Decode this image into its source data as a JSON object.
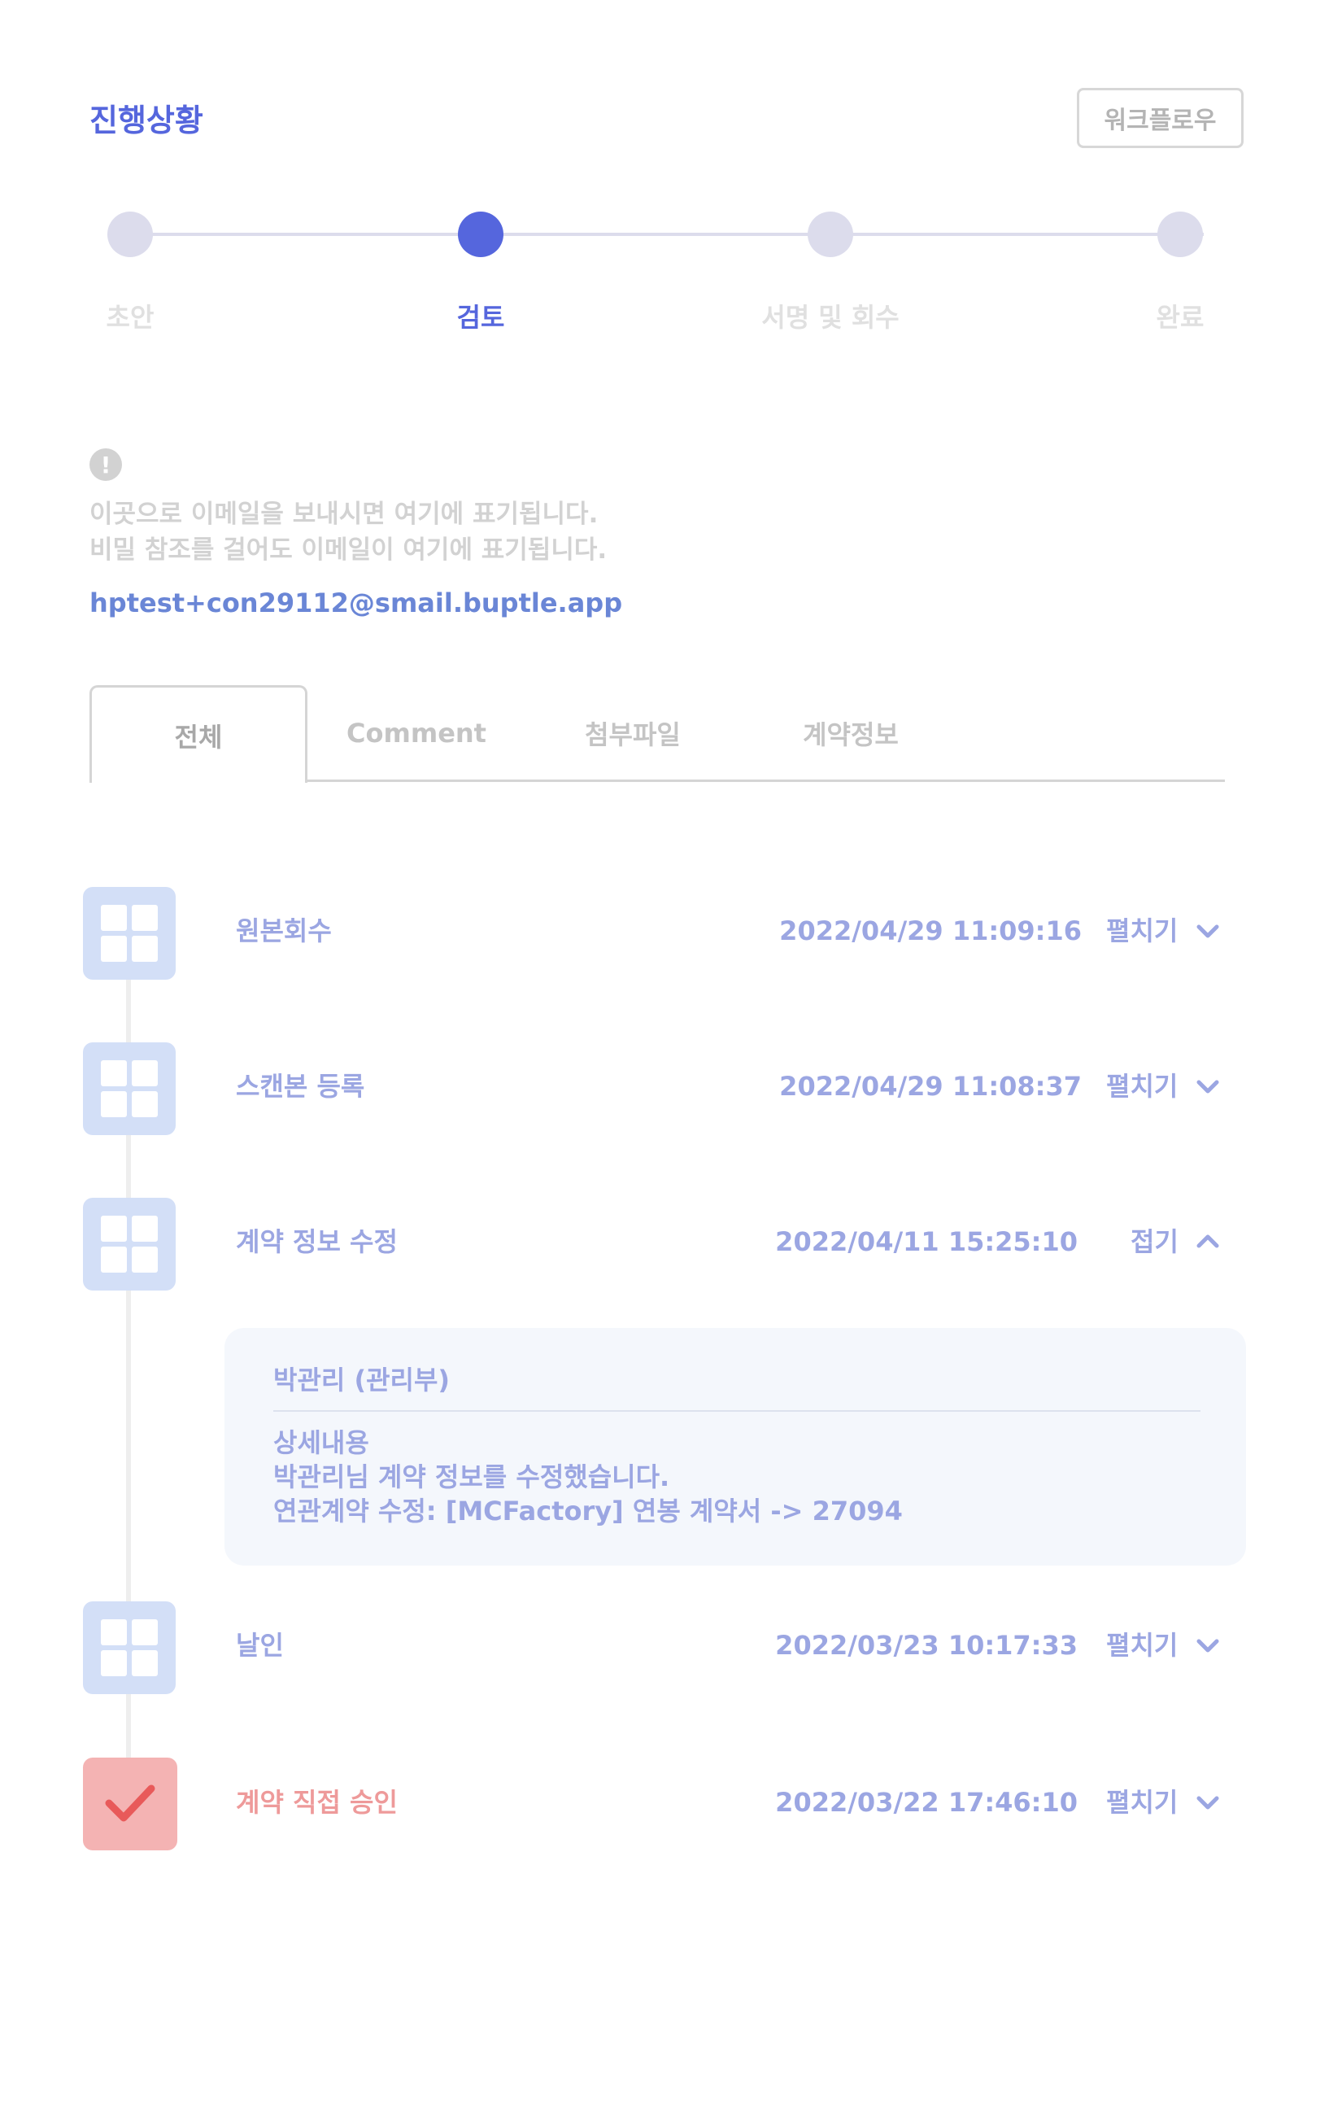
{
  "header": {
    "title": "진행상황",
    "workflow_button": "워크플로우"
  },
  "stepper": {
    "steps": [
      {
        "label": "초안",
        "active": false
      },
      {
        "label": "검토",
        "active": true
      },
      {
        "label": "서명 및 회수",
        "active": false
      },
      {
        "label": "완료",
        "active": false
      }
    ]
  },
  "notice": {
    "line1": "이곳으로 이메일을 보내시면 여기에 표기됩니다.",
    "line2": "비밀 참조를 걸어도 이메일이 여기에 표기됩니다.",
    "email": "hptest+con29112@smail.buptle.app",
    "icon": "exclamation-icon"
  },
  "tabs": [
    {
      "label": "전체",
      "active": true
    },
    {
      "label": "Comment",
      "active": false
    },
    {
      "label": "첨부파일",
      "active": false
    },
    {
      "label": "계약정보",
      "active": false
    }
  ],
  "timeline": [
    {
      "title": "원본회수",
      "date": "2022/04/29 11:09:16",
      "toggle": "펼치기",
      "expanded": false,
      "icon": "grid-icon"
    },
    {
      "title": "스캔본 등록",
      "date": "2022/04/29 11:08:37",
      "toggle": "펼치기",
      "expanded": false,
      "icon": "grid-icon"
    },
    {
      "title": "계약 정보 수정",
      "date": "2022/04/11 15:25:10",
      "toggle": "접기",
      "expanded": true,
      "icon": "grid-icon"
    },
    {
      "title": "날인",
      "date": "2022/03/23 10:17:33",
      "toggle": "펼치기",
      "expanded": false,
      "icon": "grid-icon"
    },
    {
      "title": "계약 직접 승인",
      "date": "2022/03/22 17:46:10",
      "toggle": "펼치기",
      "expanded": false,
      "icon": "check-icon"
    }
  ],
  "detail": {
    "author": "박관리 (관리부)",
    "heading": "상세내용",
    "line1": "박관리님 계약 정보를 수정했습니다.",
    "line2": "연관계약 수정: [MCFactory] 연봉 계약서 -> 27094"
  },
  "colors": {
    "accent": "#5566dd",
    "timeline_text": "#9ba6e2",
    "timeline_icon": "#d3dff7",
    "approval_red": "#ee9a9a"
  }
}
